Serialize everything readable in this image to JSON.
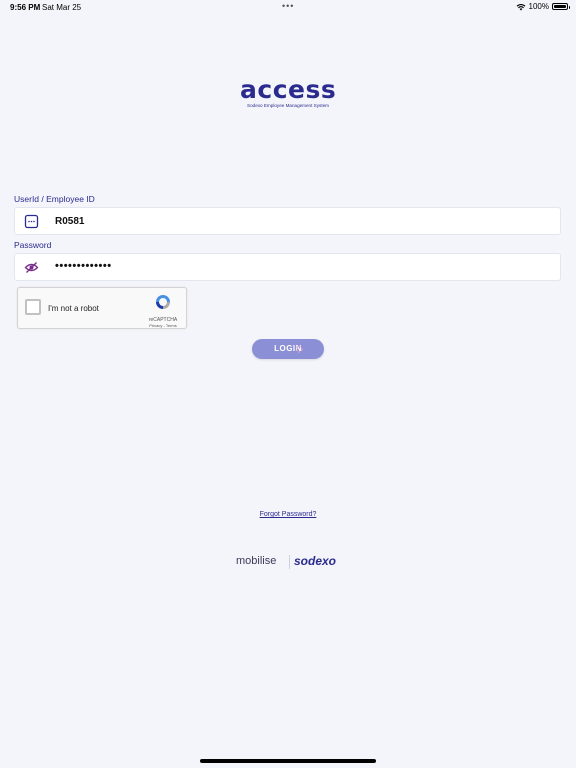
{
  "status_bar": {
    "time": "9:56 PM",
    "date": "Sat Mar 25",
    "battery": "100%"
  },
  "brand": {
    "logo_text": "access",
    "tagline": "Sodexo Employee Management System"
  },
  "form": {
    "userid_label": "UserId / Employee ID",
    "userid_value": "R0581",
    "password_label": "Password",
    "password_value": "•••••••••••••"
  },
  "recaptcha": {
    "label": "I'm not a robot",
    "brand": "reCAPTCHA",
    "links": "Privacy - Terms"
  },
  "login_button": {
    "label": "LOGIN"
  },
  "forgot_password": {
    "label": "Forgot Password?"
  },
  "footer": {
    "mobilise": "mobilise",
    "sodexo": "sodexo"
  },
  "colors": {
    "background": "#f4f5fa",
    "accent": "#2b2b8f",
    "button": "#8b8fd6"
  }
}
